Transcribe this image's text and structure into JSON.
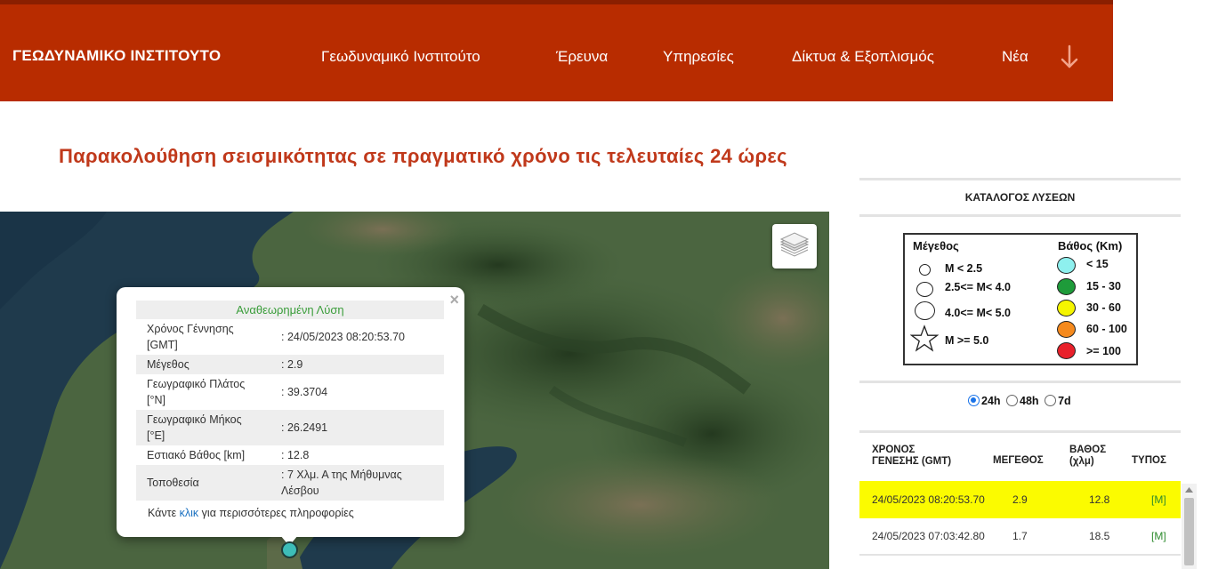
{
  "header": {
    "brand": "ΓΕΩΔΥΝΑΜΙΚΟ ΙΝΣΤΙΤΟΥΤΟ",
    "nav": [
      "Γεωδυναμικό Ινστιτούτο",
      "Έρευνα",
      "Υπηρεσίες",
      "Δίκτυα & Εξοπλισμός",
      "Νέα"
    ],
    "accent_color": "#b82c00"
  },
  "page_title": "Παρακολούθηση σεισμικότητας σε πραγματικό χρόνο τις τελευταίες 24 ώρες",
  "popup": {
    "title": "Αναθεωρημένη Λύση",
    "close": "×",
    "rows": [
      {
        "label": "Χρόνος Γέννησης [GMT]",
        "value": ": 24/05/2023 08:20:53.70"
      },
      {
        "label": "Μέγεθος",
        "value": ": 2.9"
      },
      {
        "label": "Γεωγραφικό Πλάτος [°N]",
        "value": ": 39.3704"
      },
      {
        "label": "Γεωγραφικό Μήκος [°E]",
        "value": ": 26.2491"
      },
      {
        "label": "Εστιακό Βάθος [km]",
        "value": ": 12.8"
      },
      {
        "label": "Τοποθεσία",
        "value": ": 7 Χλμ. Α της Μήθυμνας Λέσβου"
      }
    ],
    "more_prefix": "Κάντε",
    "more_link": "κλικ",
    "more_suffix": "για περισσότερες πληροφορίες"
  },
  "catalog": {
    "title": "ΚΑΤΑΛΟΓΟΣ ΛΥΣΕΩΝ",
    "legend": {
      "magnitude_header": "Μέγεθος",
      "depth_header": "Βάθος (Km)",
      "magnitudes": [
        "M < 2.5",
        "2.5<= M< 4.0",
        "4.0<= M< 5.0",
        "M >= 5.0"
      ],
      "depths": [
        {
          "label": "< 15",
          "color": "#8ef0ee"
        },
        {
          "label": "15 - 30",
          "color": "#1e9b3a"
        },
        {
          "label": "30 - 60",
          "color": "#f5f500"
        },
        {
          "label": "60 - 100",
          "color": "#f58a1e"
        },
        {
          "label": ">= 100",
          "color": "#e8202a"
        }
      ]
    },
    "ranges": [
      "24h",
      "48h",
      "7d"
    ],
    "selected_range": "24h",
    "columns": [
      "ΧΡΟΝΟΣ ΓΕΝΕΣΗΣ (GMT)",
      "ΜΕΓΕΘΟΣ",
      "ΒΑΘΟΣ (χλμ)",
      "ΤΥΠΟΣ"
    ],
    "events": [
      {
        "time": "24/05/2023 08:20:53.70",
        "mag": "2.9",
        "depth": "12.8",
        "type": "[M]"
      },
      {
        "time": "24/05/2023 07:03:42.80",
        "mag": "1.7",
        "depth": "18.5",
        "type": "[M]"
      }
    ]
  }
}
